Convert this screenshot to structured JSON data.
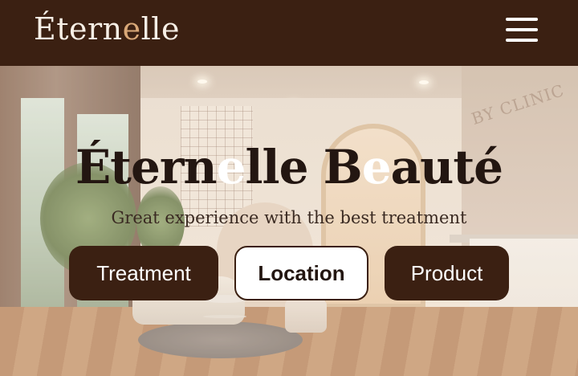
{
  "header": {
    "logo_part1": "Étern",
    "logo_accent": "e",
    "logo_part2": "lle",
    "menu_icon": "hamburger-menu-icon"
  },
  "hero": {
    "title_part1": "Étern",
    "title_hl1": "e",
    "title_part2": "lle B",
    "title_hl2": "e",
    "title_part3": "auté",
    "subtitle": "Great experience with the best treatment",
    "background_text": "BY CLINIC"
  },
  "buttons": {
    "treatment": "Treatment",
    "location": "Location",
    "product": "Product"
  },
  "colors": {
    "brand_dark": "#3b2012",
    "accent": "#d9a878",
    "white": "#ffffff"
  }
}
